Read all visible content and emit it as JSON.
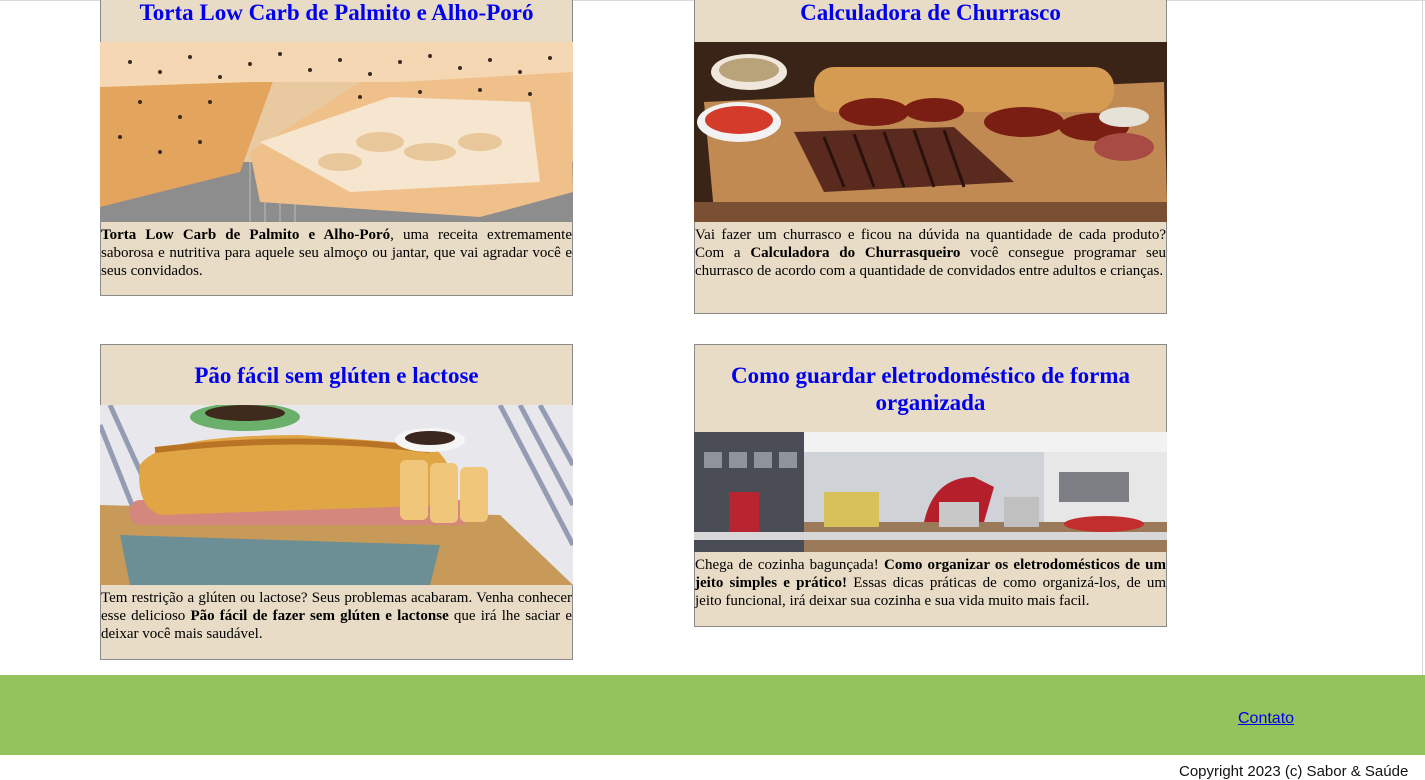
{
  "cards": [
    {
      "title": "Torta Low Carb de Palmito e Alho-Poró",
      "image_alt": "torta low carb",
      "text_bold": "Torta Low Carb de Palmito e Alho-Poró",
      "text_rest": ", uma receita extremamente saborosa e nutritiva para aquele seu almoço ou jantar, que vai agradar você e seus convidados."
    },
    {
      "title": "Calculadora de Churrasco",
      "image_alt": "churrasco",
      "text_pre": "Vai fazer um churrasco e ficou na dúvida na quantidade de cada produto? Com a ",
      "text_bold": "Calculadora do Churrasqueiro",
      "text_post": " você consegue programar seu churrasco de acordo com a quantidade de convidados entre adultos e crianças."
    },
    {
      "title": "Pão fácil sem glúten e lactose",
      "image_alt": "pão sem glúten",
      "text_pre": "Tem restrição a glúten ou lactose? Seus problemas acabaram. Venha conhecer esse delicioso ",
      "text_bold": "Pão fácil de fazer sem glúten e lactonse",
      "text_post": " que irá lhe saciar e deixar você mais saudável."
    },
    {
      "title": "Como guardar eletrodoméstico de forma organizada",
      "image_alt": "cozinha organizada",
      "text_pre": "Chega de cozinha bagunçada! ",
      "text_bold": "Como organizar os eletrodomésticos de um jeito simples e prático!",
      "text_post": " Essas dicas práticas de como organizá-los, de um jeito funcional, irá deixar sua cozinha e sua vida muito mais facil."
    }
  ],
  "footer": {
    "contact_link": "Contato",
    "copyright": "Copyright 2023 (c) Sabor & Saúde"
  },
  "colors": {
    "card_bg": "#e8dcc6",
    "title_link": "#0000ee",
    "footer_bg": "#95c35b"
  }
}
